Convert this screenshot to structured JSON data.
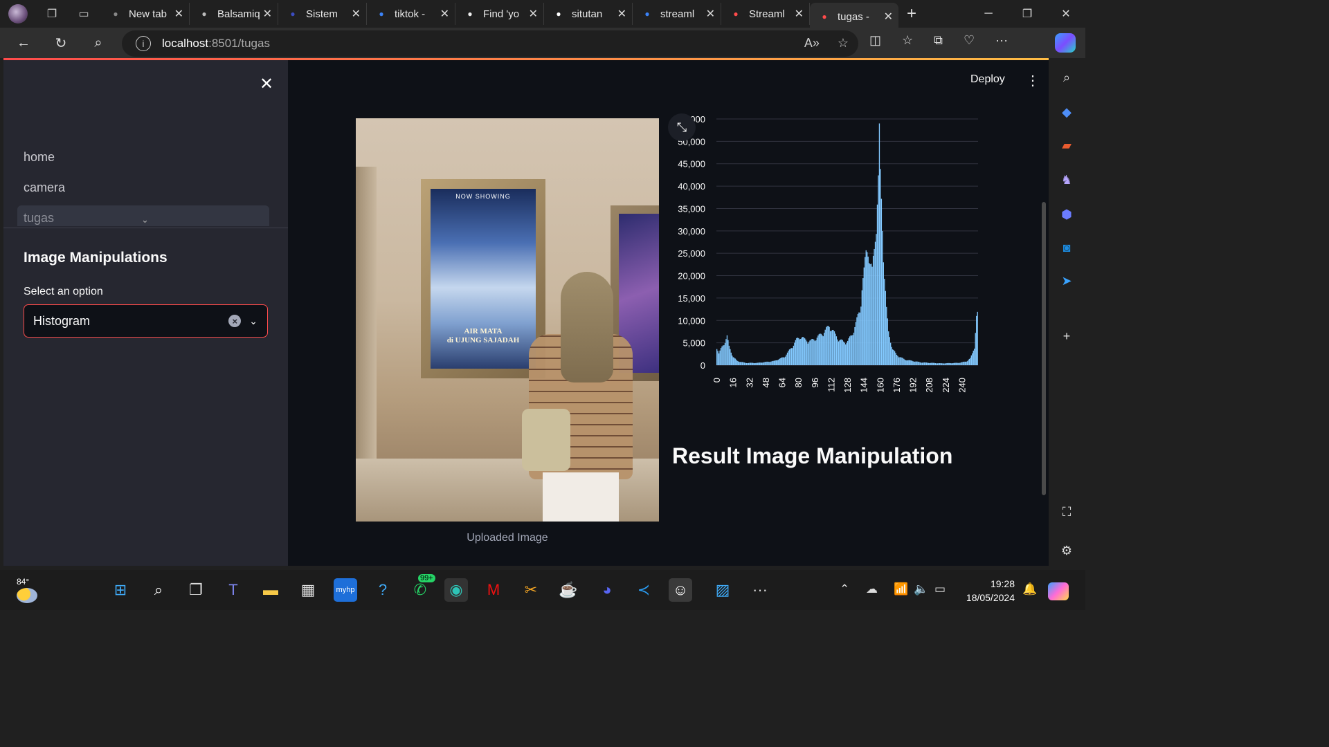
{
  "browser": {
    "tabs": [
      {
        "title": "New tab",
        "favicon": "newtab-icon",
        "active": false
      },
      {
        "title": "Balsamiq",
        "favicon": "balsamiq-icon",
        "active": false
      },
      {
        "title": "Sistem",
        "favicon": "app-icon",
        "active": false
      },
      {
        "title": "tiktok -",
        "favicon": "search-icon",
        "active": false
      },
      {
        "title": "Find 'yo",
        "favicon": "tiktok-icon",
        "active": false
      },
      {
        "title": "situtan",
        "favicon": "github-icon",
        "active": false
      },
      {
        "title": "streaml",
        "favicon": "search-icon",
        "active": false
      },
      {
        "title": "Streaml",
        "favicon": "streamlit-icon",
        "active": false
      },
      {
        "title": "tugas -",
        "favicon": "streamlit-icon",
        "active": true
      }
    ],
    "url_host": "localhost",
    "url_rest": ":8501/tugas"
  },
  "sidebar": {
    "nav": [
      "home",
      "camera",
      "tugas"
    ],
    "heading": "Image Manipulations",
    "select_label": "Select an option",
    "select_value": "Histogram"
  },
  "toolbar": {
    "deploy_label": "Deploy"
  },
  "main": {
    "image_caption": "Uploaded Image",
    "poster_header": "NOW SHOWING",
    "poster_title_line1": "AIR MATA",
    "poster_title_line2": "di UJUNG SAJADAH",
    "result_title": "Result Image Manipulation"
  },
  "chart_data": {
    "type": "bar",
    "title": "",
    "xlabel": "",
    "ylabel": "",
    "x_ticks": [
      0,
      16,
      32,
      48,
      64,
      80,
      96,
      112,
      128,
      144,
      160,
      176,
      192,
      208,
      224,
      240
    ],
    "y_ticks": [
      "0",
      "5,000",
      "10,000",
      "15,000",
      "20,000",
      "25,000",
      "30,000",
      "35,000",
      "40,000",
      "45,000",
      "50,000",
      "55,000"
    ],
    "xlim": [
      0,
      255
    ],
    "ylim": [
      0,
      55000
    ],
    "grid": true,
    "color": "#83c9ff",
    "anchors": [
      [
        0,
        4000
      ],
      [
        2,
        2500
      ],
      [
        4,
        3500
      ],
      [
        8,
        5200
      ],
      [
        10,
        6200
      ],
      [
        12,
        4000
      ],
      [
        16,
        1800
      ],
      [
        20,
        900
      ],
      [
        28,
        500
      ],
      [
        40,
        500
      ],
      [
        56,
        900
      ],
      [
        66,
        1800
      ],
      [
        72,
        3500
      ],
      [
        78,
        5500
      ],
      [
        82,
        6300
      ],
      [
        86,
        5500
      ],
      [
        92,
        5200
      ],
      [
        100,
        6300
      ],
      [
        106,
        7500
      ],
      [
        110,
        8500
      ],
      [
        112,
        8000
      ],
      [
        116,
        6500
      ],
      [
        120,
        5500
      ],
      [
        124,
        5000
      ],
      [
        128,
        5200
      ],
      [
        132,
        6500
      ],
      [
        136,
        9000
      ],
      [
        140,
        12000
      ],
      [
        142,
        17000
      ],
      [
        144,
        20000
      ],
      [
        146,
        24000
      ],
      [
        148,
        26000
      ],
      [
        150,
        22000
      ],
      [
        152,
        20000
      ],
      [
        154,
        25000
      ],
      [
        156,
        32000
      ],
      [
        158,
        40000
      ],
      [
        160,
        40000
      ],
      [
        162,
        30000
      ],
      [
        164,
        20000
      ],
      [
        166,
        12000
      ],
      [
        168,
        7000
      ],
      [
        172,
        3500
      ],
      [
        176,
        2200
      ],
      [
        184,
        1200
      ],
      [
        200,
        600
      ],
      [
        220,
        400
      ],
      [
        236,
        500
      ],
      [
        244,
        800
      ],
      [
        248,
        1500
      ],
      [
        250,
        2500
      ],
      [
        252,
        4000
      ],
      [
        254,
        11000
      ]
    ],
    "peaks": [
      [
        159,
        54000
      ],
      [
        254,
        11000
      ]
    ]
  },
  "taskbar": {
    "weather_temp": "84°",
    "time": "19:28",
    "date": "18/05/2024",
    "whatsapp_badge": "99+"
  }
}
